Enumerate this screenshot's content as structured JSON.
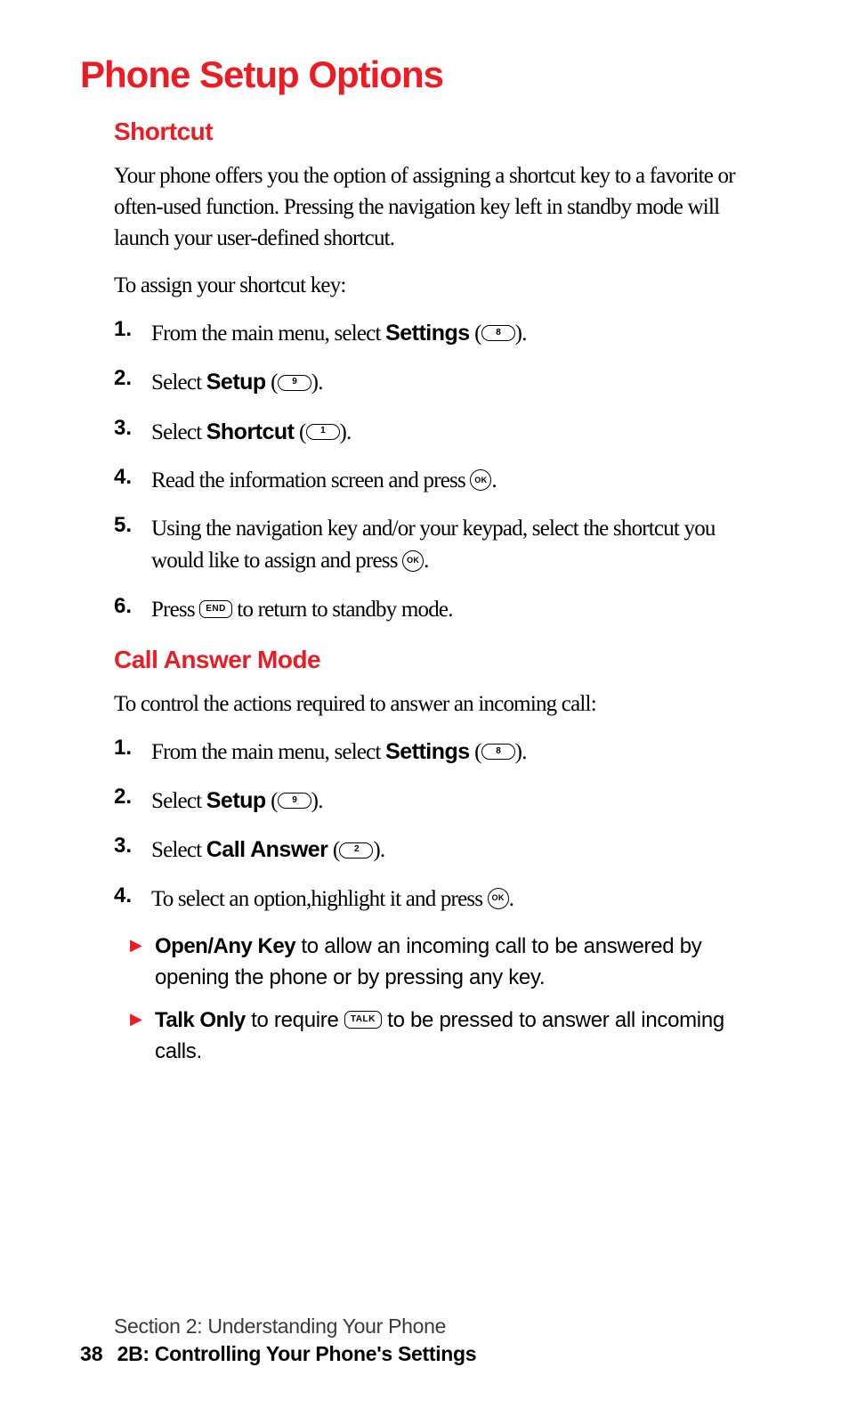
{
  "h1": "Phone Setup Options",
  "shortcut": {
    "heading": "Shortcut",
    "intro": "Your phone offers you the option of assigning a shortcut key to a favorite or often-used function. Pressing the navigation key left in standby mode will launch your user-defined shortcut.",
    "lead": "To assign your shortcut key:",
    "steps": {
      "s1": {
        "num": "1.",
        "pre": "From the main menu, select ",
        "bold": "Settings",
        "post": " (",
        "key": "8",
        "end": ")."
      },
      "s2": {
        "num": "2.",
        "pre": "Select ",
        "bold": "Setup",
        "post": " (",
        "key": "9",
        "end": ")."
      },
      "s3": {
        "num": "3.",
        "pre": "Select ",
        "bold": "Shortcut",
        "post": " (",
        "key": "1",
        "end": ")."
      },
      "s4": {
        "num": "4.",
        "pre": "Read the information screen and press ",
        "key": "OK",
        "end": "."
      },
      "s5": {
        "num": "5.",
        "pre": "Using the navigation key and/or your keypad, select the shortcut you would like to assign and press ",
        "key": "OK",
        "end": "."
      },
      "s6": {
        "num": "6.",
        "pre": "Press ",
        "key": "END",
        "post": " to return to standby mode."
      }
    }
  },
  "callAnswer": {
    "heading": "Call Answer Mode",
    "lead": "To control the actions required to answer an incoming call:",
    "steps": {
      "s1": {
        "num": "1.",
        "pre": "From the main menu, select ",
        "bold": "Settings",
        "post": " (",
        "key": "8",
        "end": ")."
      },
      "s2": {
        "num": "2.",
        "pre": "Select ",
        "bold": "Setup",
        "post": " (",
        "key": "9",
        "end": ")."
      },
      "s3": {
        "num": "3.",
        "pre": "Select ",
        "bold": "Call Answer",
        "post": " (",
        "key": "2",
        "end": ")."
      },
      "s4": {
        "num": "4.",
        "pre": "To select an option,highlight it and press ",
        "key": "OK",
        "end": "."
      }
    },
    "bullets": {
      "b1": {
        "bold": "Open/Any Key",
        "text": " to allow an incoming call to be answered by opening the phone or by pressing any key."
      },
      "b2": {
        "bold": "Talk Only",
        "pre": " to require ",
        "key": "TALK",
        "post": " to be pressed to answer all incoming calls."
      }
    }
  },
  "footer": {
    "section": "Section 2: Understanding Your Phone",
    "page": "38",
    "chapter": "2B: Controlling Your Phone's Settings"
  },
  "marker": "▶"
}
